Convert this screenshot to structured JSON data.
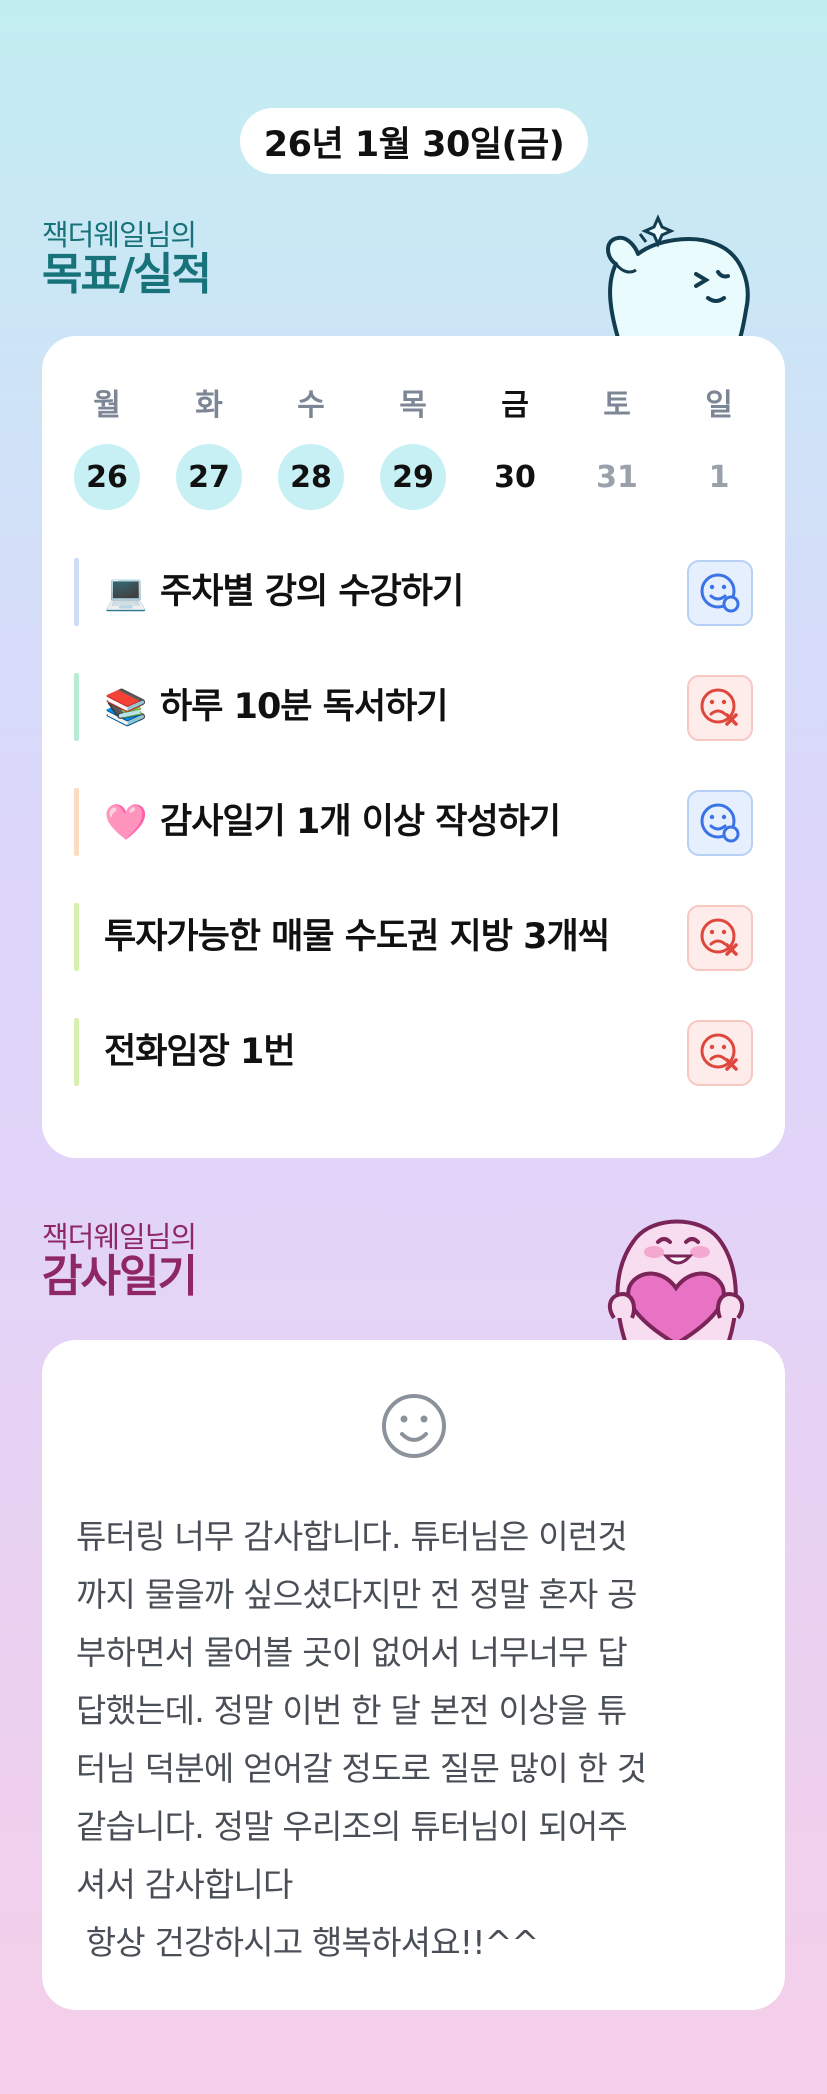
{
  "date_label": "26년 1월 30일(금)",
  "goal_section": {
    "owner": "잭더웨일님의",
    "title": "목표/실적"
  },
  "week": [
    {
      "name": "월",
      "date": "26",
      "state": "done"
    },
    {
      "name": "화",
      "date": "27",
      "state": "done"
    },
    {
      "name": "수",
      "date": "28",
      "state": "done"
    },
    {
      "name": "목",
      "date": "29",
      "state": "done"
    },
    {
      "name": "금",
      "date": "30",
      "state": "today"
    },
    {
      "name": "토",
      "date": "31",
      "state": "future"
    },
    {
      "name": "일",
      "date": "1",
      "state": "future"
    }
  ],
  "goals": [
    {
      "emoji": "💻",
      "text": "주차별 강의 수강하기",
      "status": "success",
      "bar_color": "#cfdcf5"
    },
    {
      "emoji": "📚",
      "text": "하루 10분 독서하기",
      "status": "fail",
      "bar_color": "#b9ecd5"
    },
    {
      "emoji": "🩷",
      "text": "감사일기 1개 이상 작성하기",
      "status": "success",
      "bar_color": "#fcdcc0"
    },
    {
      "emoji": "",
      "text": "투자가능한 매물 수도권 지방 3개씩",
      "status": "fail",
      "bar_color": "#d7f0b0"
    },
    {
      "emoji": "",
      "text": "전화임장 1번",
      "status": "fail",
      "bar_color": "#d7f0b0"
    }
  ],
  "thanks_section": {
    "owner": "잭더웨일님의",
    "title": "감사일기"
  },
  "diary_lines": [
    "튜터링 너무 감사합니다. 튜터님은 이런것",
    "까지 물을까 싶으셨다지만 전 정말 혼자 공",
    "부하면서 물어볼 곳이 없어서 너무너무 답",
    "답했는데. 정말 이번 한 달 본전 이상을 튜",
    "터님 덕분에 얻어갈 정도로 질문 많이 한 것",
    "같습니다. 정말 우리조의 튜터님이 되어주",
    "셔서 감사합니다",
    " 항상 건강하시고 행복하셔요!!^^"
  ],
  "colors": {
    "goal_title": "#17727a",
    "thanks_title": "#8e2763",
    "done_circle": "#c6f0f3",
    "success_icon": "#3a73e6",
    "fail_icon": "#e0473c"
  },
  "icons": {
    "success": "smile-check-icon",
    "fail": "frown-x-icon",
    "diary_mood": "smile-icon"
  }
}
